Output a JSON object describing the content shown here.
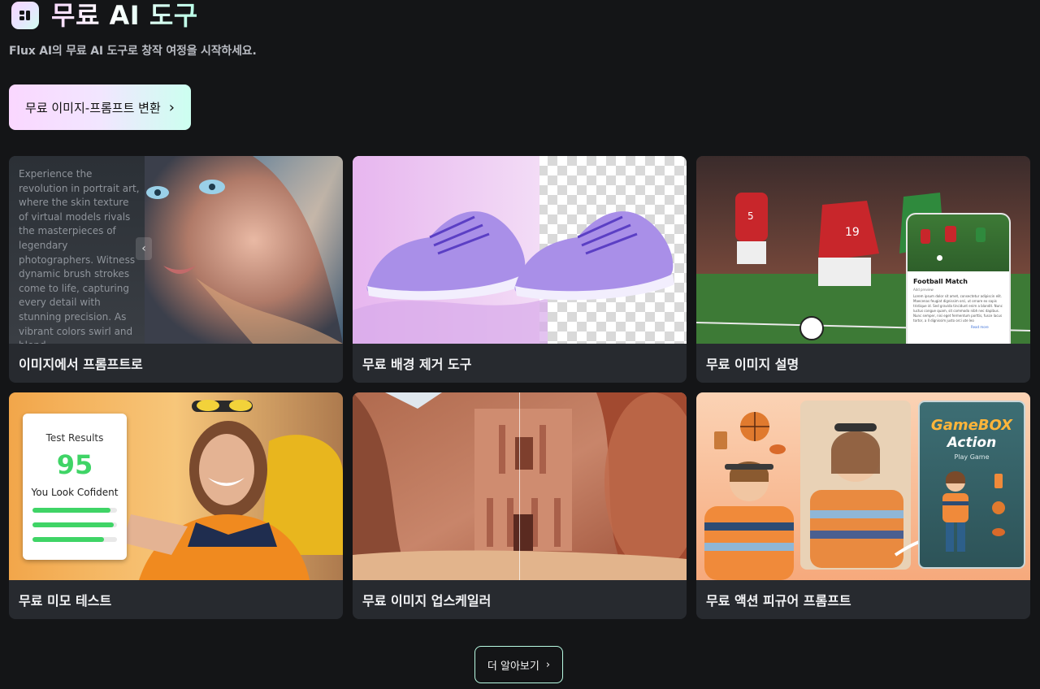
{
  "header": {
    "logo_icon": "flux-logo-icon",
    "title": "무료 AI 도구",
    "subtitle": "Flux AI의 무료 AI 도구로 창작 여정을 시작하세요."
  },
  "cta": {
    "label": "무료 이미지-프롬프트 변환",
    "icon": "chevron-right-icon"
  },
  "tools": [
    {
      "label": "이미지에서 프롬프트로"
    },
    {
      "label": "무료 배경 제거 도구"
    },
    {
      "label": "무료 이미지 설명"
    },
    {
      "label": "무료 미모 테스트"
    },
    {
      "label": "무료 이미지 업스케일러"
    },
    {
      "label": "무료 액션 피규어 프롬프트"
    }
  ],
  "media": {
    "prompt_text": "Experience the revolution in portrait art, where the skin texture of virtual models rivals the masterpieces of legendary photographers. Witness dynamic brush strokes come to life, capturing every detail with stunning precision. As vibrant colors swirl and blend...",
    "football_title": "Football Match",
    "football_kicker": "Add preview",
    "football_body": "Lorem ipsum dolor sit amet, consectetur adipiscin elit. Maecenas feugiat dignissim orci, ut ornare ex sapis tristique id. Sed gravida tincidunt enim a blandit. Nunc luctus congue quam, sit commodo nibh nec dapibus. Nunc semper, nisi eget fermentum porttis, fusce lacus tortor, a ll dignissim justo orci ute leo",
    "football_read_more": "Read more",
    "shirt_numbers": [
      "5",
      "19"
    ],
    "test_title": "Test Results",
    "test_score": "95",
    "test_sub": "You Look Cofident",
    "test_bars": [
      0.92,
      0.96,
      0.85
    ],
    "gamebox_title": "GameBOX",
    "gamebox_sub": "Action",
    "gamebox_play": "Play Game"
  },
  "more_button": {
    "label": "더 알아보기",
    "icon": "chevron-right-icon"
  }
}
